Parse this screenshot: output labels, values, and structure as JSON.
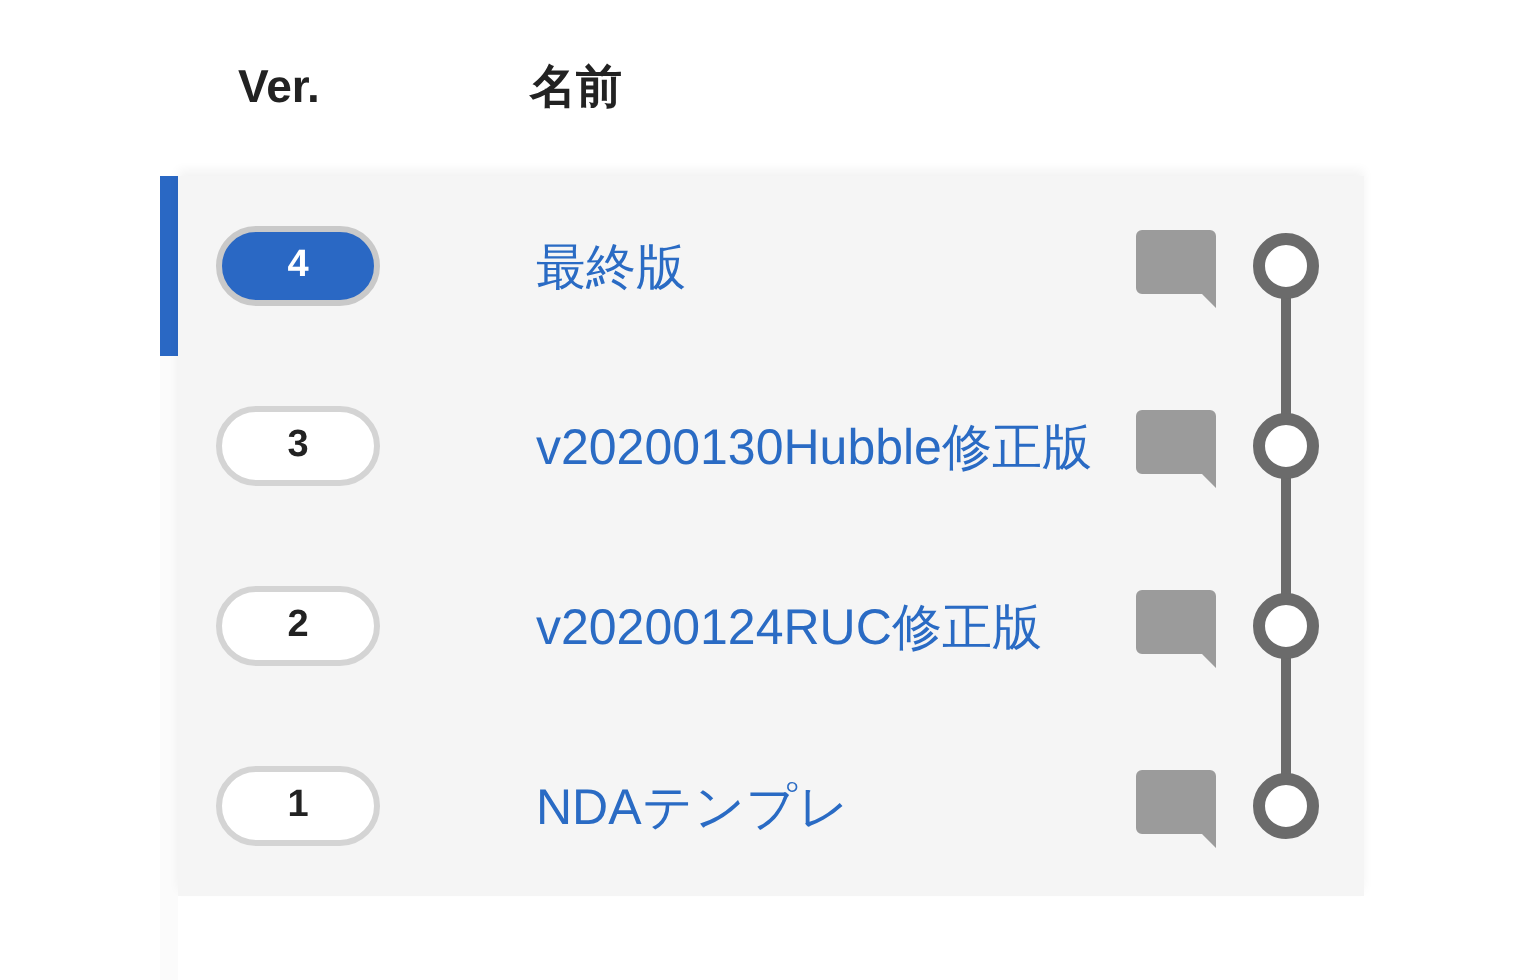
{
  "columns": [
    {
      "label": "Ver."
    },
    {
      "label": "名前"
    }
  ],
  "versions": [
    {
      "number": "4",
      "name": "最終版",
      "selected": true
    },
    {
      "number": "3",
      "name": "v20200130Hubble修正版",
      "selected": false
    },
    {
      "number": "2",
      "name": "v20200124RUC修正版",
      "selected": false
    },
    {
      "number": "1",
      "name": "NDAテンプレ",
      "selected": false
    }
  ]
}
